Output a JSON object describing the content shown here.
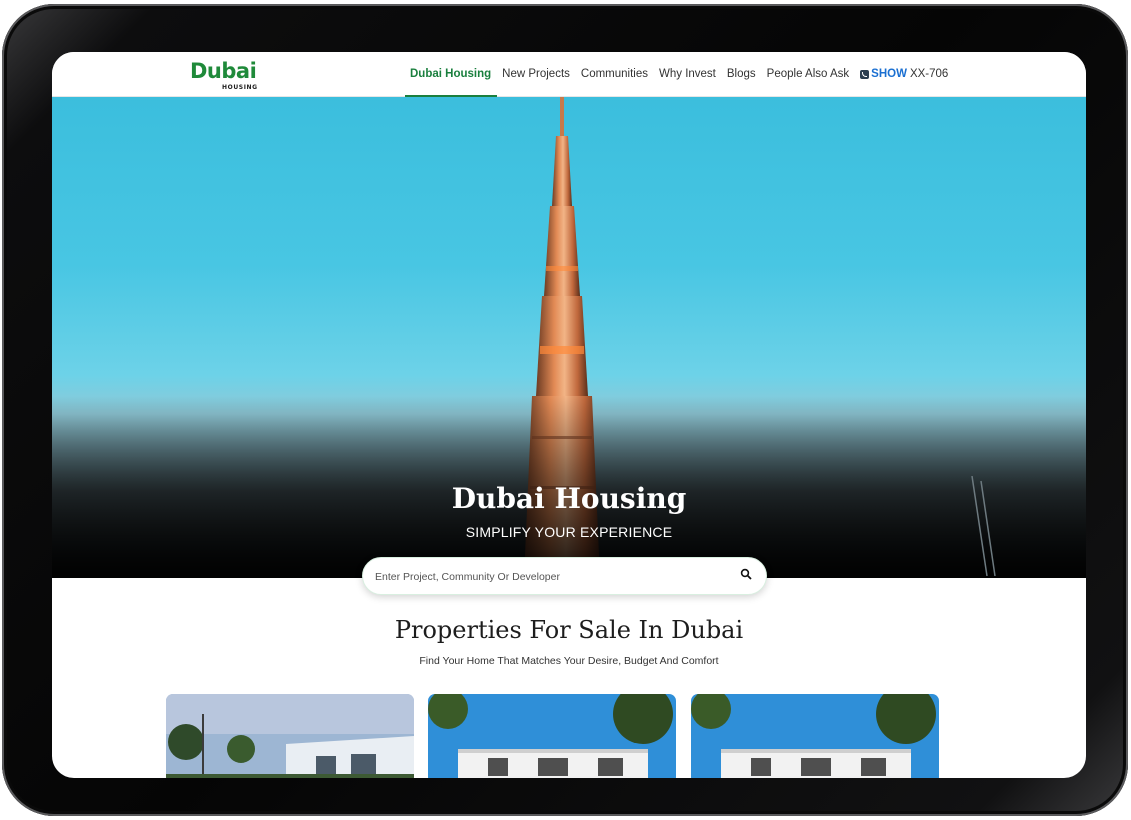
{
  "header": {
    "logo_main": "Dubai",
    "logo_sub": "HOUSING",
    "nav": [
      {
        "label": "Dubai Housing",
        "active": true
      },
      {
        "label": "New Projects"
      },
      {
        "label": "Communities"
      },
      {
        "label": "Why Invest"
      },
      {
        "label": "Blogs"
      },
      {
        "label": "People Also Ask"
      }
    ],
    "phone_show": "SHOW",
    "phone_number": "XX-706"
  },
  "hero": {
    "title": "Dubai Housing",
    "subtitle": "SIMPLIFY YOUR EXPERIENCE",
    "search_placeholder": "Enter Project, Community Or Developer"
  },
  "section": {
    "title": "Properties For Sale In Dubai",
    "subtitle": "Find Your Home That Matches Your Desire, Budget And Comfort"
  },
  "colors": {
    "brand_green": "#1a7f3e",
    "phone_blue": "#1a6fd1",
    "sky": "#48c6e3"
  },
  "icons": {
    "search": "search-icon",
    "phone": "phone-icon"
  }
}
